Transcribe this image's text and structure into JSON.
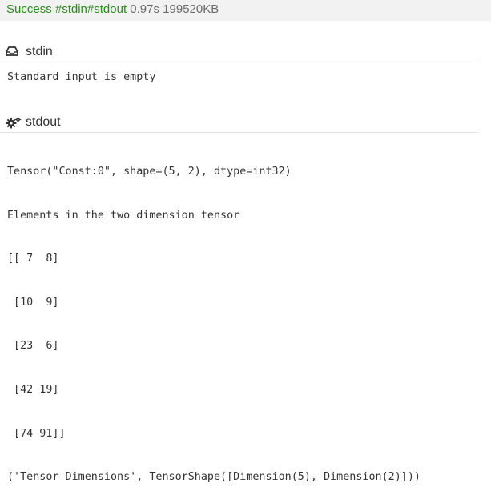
{
  "status": {
    "result": "Success",
    "tags": [
      "#stdin",
      "#stdout"
    ],
    "time": "0.97s",
    "memory": "199520KB"
  },
  "stdin": {
    "title": "stdin",
    "icon": "inbox-icon",
    "content": "Standard input is empty"
  },
  "stdout": {
    "title": "stdout",
    "icon": "gears-icon",
    "lines": [
      "Tensor(\"Const:0\", shape=(5, 2), dtype=int32)",
      "Elements in the two dimension tensor",
      "[[ 7  8]",
      " [10  9]",
      " [23  6]",
      " [42 19]",
      " [74 91]]",
      "('Tensor Dimensions', TensorShape([Dimension(5), Dimension(2)]))"
    ]
  }
}
